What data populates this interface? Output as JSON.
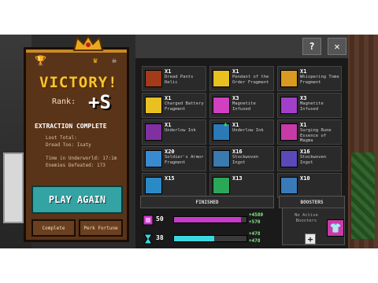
{
  "results": {
    "title": "VICTORY!",
    "rank_label": "Rank:",
    "rank_value": "+S",
    "extraction_status": "EXTRACTION COMPLETE",
    "stats": [
      "Loot Total:",
      "Dread Too:     Isaty",
      "Time in Underworld: 17:1m",
      "Enemies Defeated: 173"
    ],
    "play_again_label": "PLAY AGAIN",
    "left_button_label": "Complete",
    "right_button_label": "Perk Fortune"
  },
  "toolbar": {
    "help_label": "?",
    "close_label": "✕"
  },
  "loot": [
    {
      "qty": "X1",
      "name": "Dread Pants Relic",
      "color": "#a33a1a",
      "icon": "pants-relic-icon",
      "upgrade": false
    },
    {
      "qty": "X1",
      "name": "Pendant of the Order Fragment",
      "color": "#e8c020",
      "icon": "pendant-icon",
      "upgrade": false
    },
    {
      "qty": "X1",
      "name": "Whispering Tome Fragment",
      "color": "#d89a20",
      "icon": "tome-icon",
      "upgrade": false
    },
    {
      "qty": "X1",
      "name": "Charged Battery Fragment",
      "color": "#e8c020",
      "icon": "battery-icon",
      "upgrade": false
    },
    {
      "qty": "X3",
      "name": "Magnetite Infused",
      "color": "#d040c0",
      "icon": "magnetite-icon",
      "upgrade": false
    },
    {
      "qty": "X3",
      "name": "Magnetite Infused",
      "color": "#a040c8",
      "icon": "magnetite-icon",
      "upgrade": false
    },
    {
      "qty": "X1",
      "name": "Underlow Ink",
      "color": "#8030a0",
      "icon": "ink-icon",
      "upgrade": false
    },
    {
      "qty": "X1",
      "name": "Underlow Ink",
      "color": "#2a7ab8",
      "icon": "ink-icon",
      "upgrade": true
    },
    {
      "qty": "X1",
      "name": "Surging Rune Essence of Magma",
      "color": "#c83aa8",
      "icon": "rune-icon",
      "upgrade": false
    },
    {
      "qty": "X20",
      "name": "Soldier's Armor Fragment",
      "color": "#3a8ad0",
      "icon": "armor-icon",
      "upgrade": false
    },
    {
      "qty": "X16",
      "name": "Stockwoven Ingot",
      "color": "#3a7ab0",
      "icon": "ingot-icon",
      "upgrade": false
    },
    {
      "qty": "X16",
      "name": "Stockwoven Ingot",
      "color": "#5a4ab8",
      "icon": "ingot-icon",
      "upgrade": false
    },
    {
      "qty": "X15",
      "name": "",
      "color": "#2a8ac8",
      "icon": "gem-icon",
      "upgrade": false
    },
    {
      "qty": "X13",
      "name": "",
      "color": "#2aa858",
      "icon": "gem-icon",
      "upgrade": false
    },
    {
      "qty": "X10",
      "name": "",
      "color": "#3a7ab8",
      "icon": "gem-icon",
      "upgrade": false
    }
  ],
  "sections": {
    "progress_label": "FINISHED",
    "boosters_label": "BOOSTERS"
  },
  "progress": [
    {
      "value": "50",
      "gain_top": "+4580",
      "gain_bottom": "+570",
      "fill": 0.92,
      "color": "#c83ac8",
      "icon": "rank-icon"
    },
    {
      "value": "38",
      "gain_top": "+478",
      "gain_bottom": "+478",
      "fill": 0.55,
      "color": "#3ad8e0",
      "icon": "hourglass-icon"
    }
  ],
  "boosters": {
    "empty_text": "No Active Boosters",
    "add_label": "+",
    "slot_icon": "shirt-icon"
  }
}
